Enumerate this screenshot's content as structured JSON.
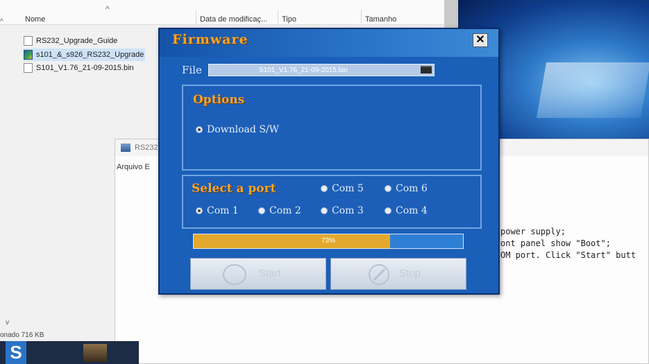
{
  "explorer": {
    "columns": [
      "Nome",
      "Data de modificaç...",
      "Tipo",
      "Tamanho"
    ],
    "files": [
      {
        "name": "RS232_Upgrade_Guide",
        "icon": "document-icon"
      },
      {
        "name": "s101_&_s926_RS232_Upgrade",
        "icon": "app-icon"
      },
      {
        "name": "S101_V1.76_21-09-2015.bin",
        "icon": "file-icon"
      }
    ],
    "status": "onado 716 KB"
  },
  "rs232_window": {
    "title": "RS232_l",
    "menu": "Arquivo E",
    "lines": [
      "power supply;",
      "ont panel show \"Boot\";",
      "OM port. Click \"Start\" butt"
    ]
  },
  "firmware_dialog": {
    "title": "Firmware",
    "close_label": "✕",
    "file_label": "File",
    "file_value": "S101_V1.76_21-09-2015.bin",
    "options_title": "Options",
    "option_download": "Download S/W",
    "port_title": "Select a port",
    "ports": [
      "Com 5",
      "Com 6",
      "Com 1",
      "Com 2",
      "Com 3",
      "Com 4"
    ],
    "progress_text": "73%",
    "progress_fraction": 0.73,
    "start_label": "Start",
    "stop_label": "Stop",
    "colors": {
      "accent": "#f2a52b",
      "dialog_bg": "#1e63bd",
      "progress": "#e3a92e"
    }
  }
}
